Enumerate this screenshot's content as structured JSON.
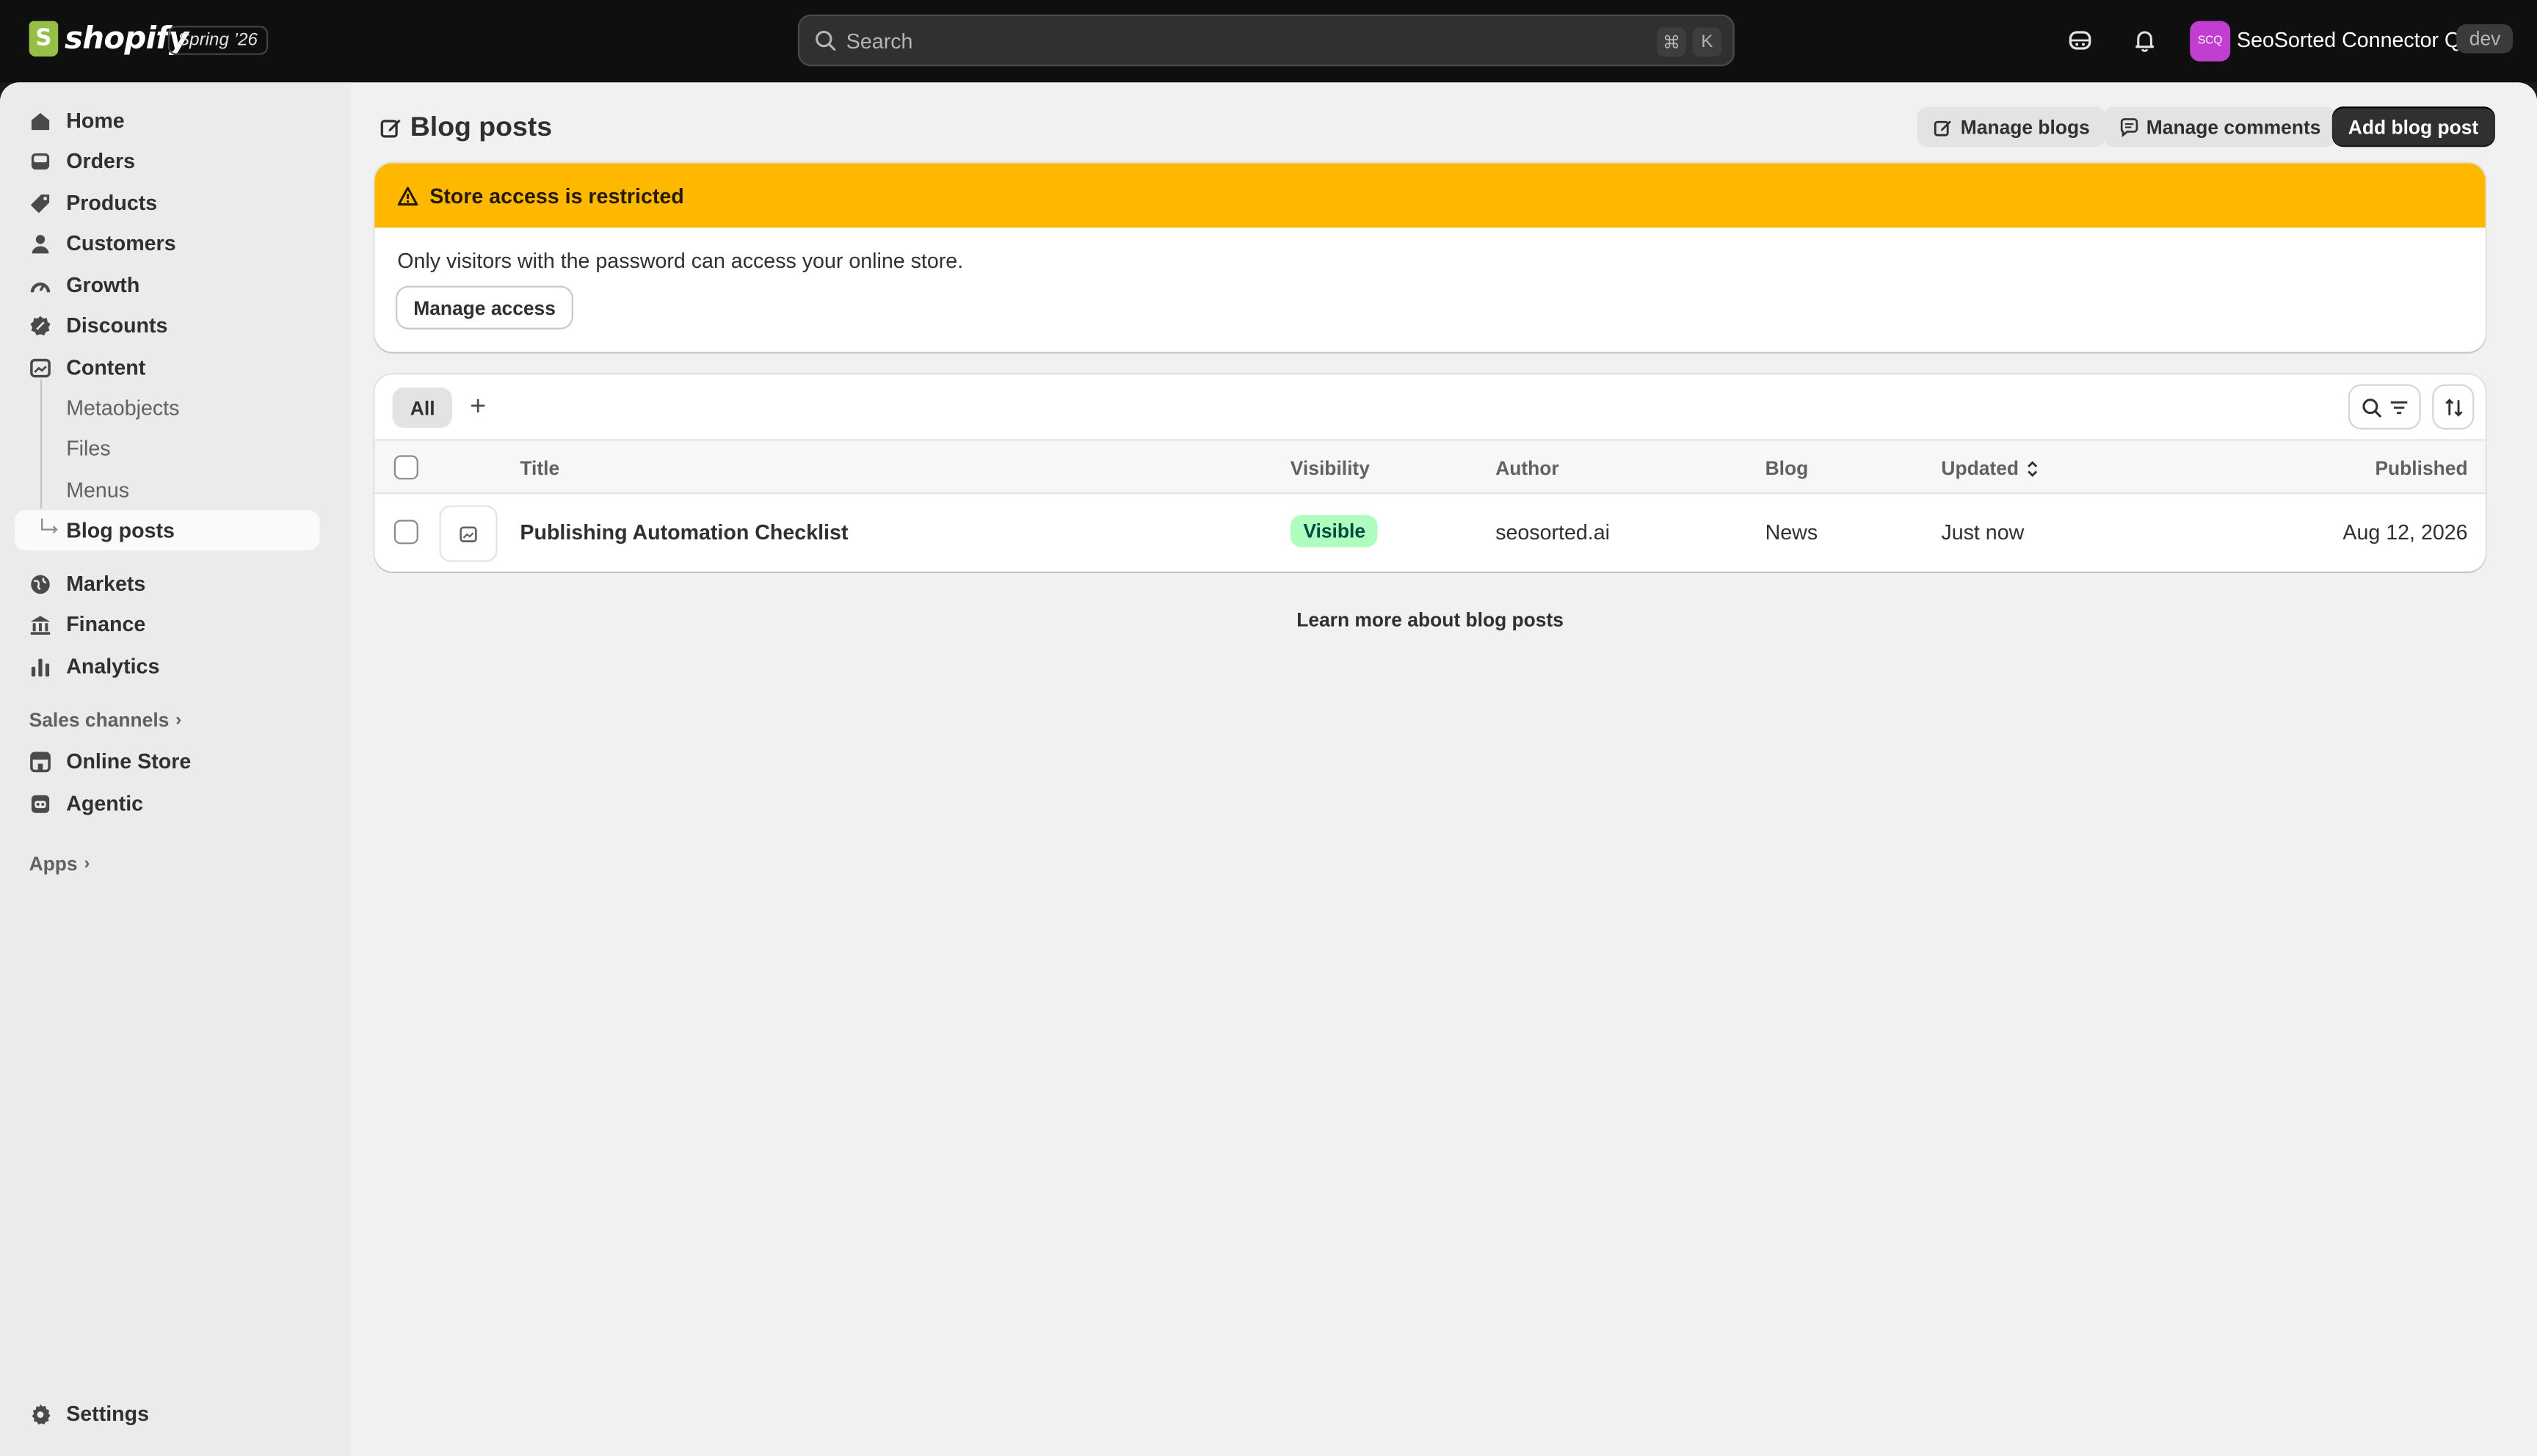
{
  "topbar": {
    "logo_text": "shopify",
    "release_badge": "Spring ’26",
    "search_placeholder": "Search",
    "shortcut_cmd": "⌘",
    "shortcut_key": "K",
    "store_initials": "SCQ",
    "store_name": "SeoSorted Connector QA",
    "env_badge": "dev",
    "avatar_color": "#c13ed1"
  },
  "sidebar": {
    "items": [
      {
        "label": "Home",
        "icon": "home-icon"
      },
      {
        "label": "Orders",
        "icon": "inbox-icon"
      },
      {
        "label": "Products",
        "icon": "tag-icon"
      },
      {
        "label": "Customers",
        "icon": "person-icon"
      },
      {
        "label": "Growth",
        "icon": "gauge-icon"
      },
      {
        "label": "Discounts",
        "icon": "discount-icon"
      },
      {
        "label": "Content",
        "icon": "content-icon"
      }
    ],
    "content_sub": [
      "Metaobjects",
      "Files",
      "Menus",
      "Blog posts"
    ],
    "items2": [
      {
        "label": "Markets",
        "icon": "globe-icon"
      },
      {
        "label": "Finance",
        "icon": "bank-icon"
      },
      {
        "label": "Analytics",
        "icon": "bar-chart-icon"
      }
    ],
    "sales_channels_label": "Sales channels",
    "channels": [
      {
        "label": "Online Store",
        "icon": "store-icon"
      },
      {
        "label": "Agentic",
        "icon": "robot-icon"
      }
    ],
    "apps_label": "Apps",
    "settings_label": "Settings"
  },
  "page": {
    "title": "Blog posts",
    "manage_blogs": "Manage blogs",
    "manage_comments": "Manage comments",
    "add_post": "Add blog post"
  },
  "banner": {
    "title": "Store access is restricted",
    "body": "Only visitors with the password can access your online store.",
    "button": "Manage access",
    "color": "#ffb800"
  },
  "table": {
    "tab_all": "All",
    "add_tab": "+",
    "columns": {
      "title": "Title",
      "visibility": "Visibility",
      "author": "Author",
      "blog": "Blog",
      "updated": "Updated",
      "published": "Published"
    },
    "rows": [
      {
        "title": "Publishing Automation Checklist",
        "visibility": "Visible",
        "author": "seosorted.ai",
        "blog": "News",
        "updated": "Just now",
        "published": "Aug 12, 2026"
      }
    ]
  },
  "footer_link": "Learn more about blog posts"
}
